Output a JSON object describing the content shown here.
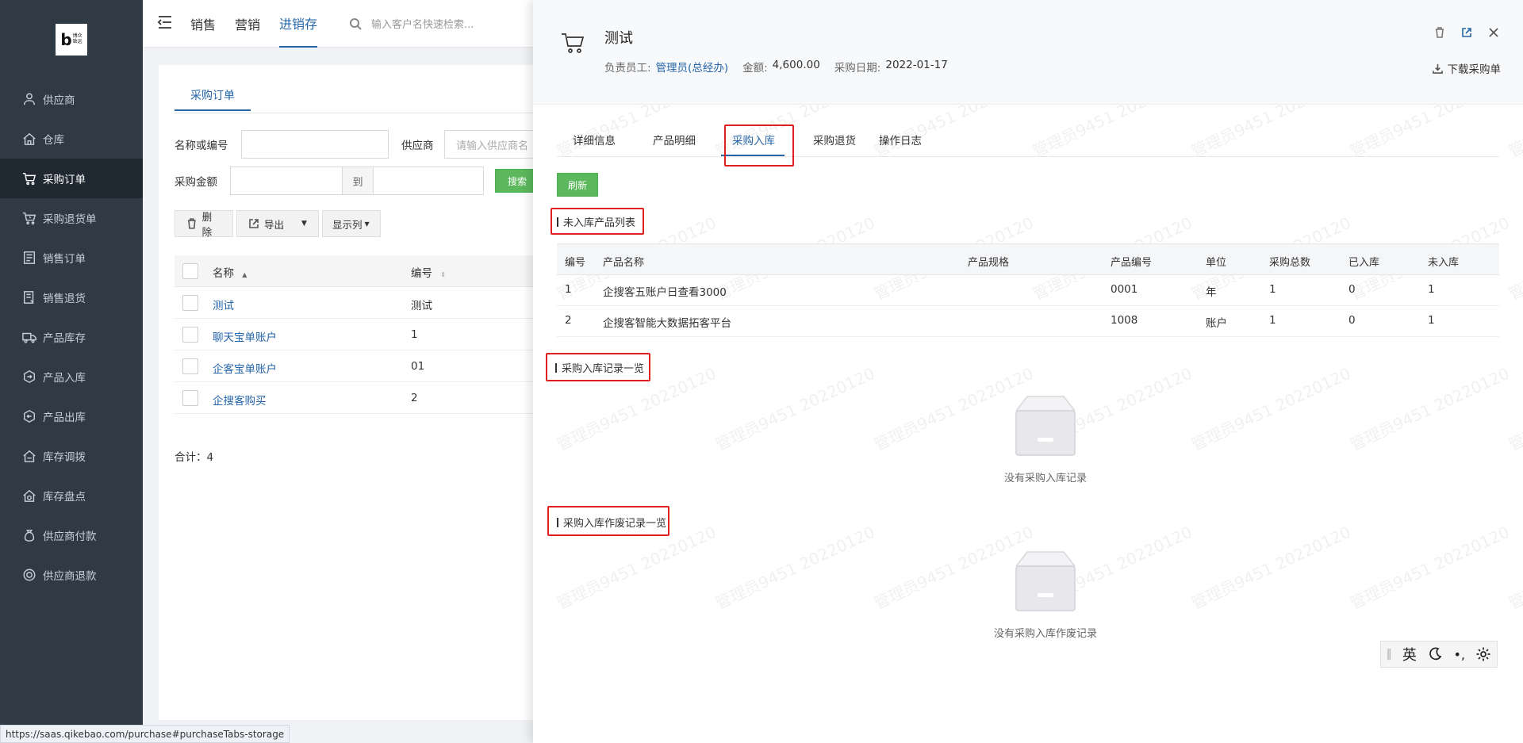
{
  "logo": {
    "mark": "b",
    "line1": "博众",
    "line2": "致远"
  },
  "sidebar": {
    "items": [
      {
        "label": "供应商",
        "icon": "person-icon",
        "active": false
      },
      {
        "label": "仓库",
        "icon": "home-icon",
        "active": false
      },
      {
        "label": "采购订单",
        "icon": "cart-icon",
        "active": true
      },
      {
        "label": "采购退货单",
        "icon": "cart-return-icon",
        "active": false
      },
      {
        "label": "销售订单",
        "icon": "list-icon",
        "active": false
      },
      {
        "label": "销售退货",
        "icon": "doc-return-icon",
        "active": false
      },
      {
        "label": "产品库存",
        "icon": "truck-icon",
        "active": false
      },
      {
        "label": "产品入库",
        "icon": "box-in-icon",
        "active": false
      },
      {
        "label": "产品出库",
        "icon": "box-out-icon",
        "active": false
      },
      {
        "label": "库存调拨",
        "icon": "transfer-icon",
        "active": false
      },
      {
        "label": "库存盘点",
        "icon": "inventory-icon",
        "active": false
      },
      {
        "label": "供应商付款",
        "icon": "money-bag-icon",
        "active": false
      },
      {
        "label": "供应商退款",
        "icon": "refund-icon",
        "active": false
      }
    ]
  },
  "topnav": {
    "tabs": [
      "销售",
      "营销",
      "进销存"
    ],
    "active_tab": "进销存",
    "search_placeholder": "输入客户名快速检索..."
  },
  "main": {
    "tab": "采购订单",
    "filters": {
      "name_label": "名称或编号",
      "supplier_label": "供应商",
      "supplier_placeholder": "请输入供应商名",
      "amount_label": "采购金额",
      "to_label": "到",
      "search_button": "搜索"
    },
    "toolbar": {
      "delete": "删除",
      "export": "导出",
      "columns": "显示列"
    },
    "table": {
      "headers": [
        "名称",
        "编号"
      ],
      "rows": [
        {
          "name": "测试",
          "code": "测试"
        },
        {
          "name": "聊天宝单账户",
          "code": "1"
        },
        {
          "name": "企客宝单账户",
          "code": "01"
        },
        {
          "name": "企搜客购买",
          "code": "2"
        }
      ]
    },
    "total": "合计：4"
  },
  "statusbar": {
    "url": "https://saas.qikebao.com/purchase#purchaseTabs-storage"
  },
  "drawer": {
    "title": "测试",
    "meta": {
      "owner_label": "负责员工:",
      "owner": "管理员(总经办)",
      "amount_label": "金额:",
      "amount": "4,600.00",
      "date_label": "采购日期:",
      "date": "2022-01-17"
    },
    "download": "下载采购单",
    "tabs": [
      "详细信息",
      "产品明细",
      "采购入库",
      "采购退货",
      "操作日志"
    ],
    "active_tab": "采购入库",
    "refresh": "刷新",
    "section1": "未入库产品列表",
    "product_table": {
      "headers": [
        "编号",
        "产品名称",
        "产品规格",
        "产品编号",
        "单位",
        "采购总数",
        "已入库",
        "未入库"
      ],
      "rows": [
        {
          "no": "1",
          "name": "企搜客五账户日查看3000",
          "spec": "",
          "code": "0001",
          "unit": "年",
          "total": "1",
          "stored": "0",
          "unstored": "1"
        },
        {
          "no": "2",
          "name": "企搜客智能大数据拓客平台",
          "spec": "",
          "code": "1008",
          "unit": "账户",
          "total": "1",
          "stored": "0",
          "unstored": "1"
        }
      ]
    },
    "section2": "采购入库记录一览",
    "empty2": "没有采购入库记录",
    "section3": "采购入库作废记录一览",
    "empty3": "没有采购入库作废记录",
    "watermark": "管理员9451 20220120"
  },
  "ime": {
    "lang": "英"
  }
}
